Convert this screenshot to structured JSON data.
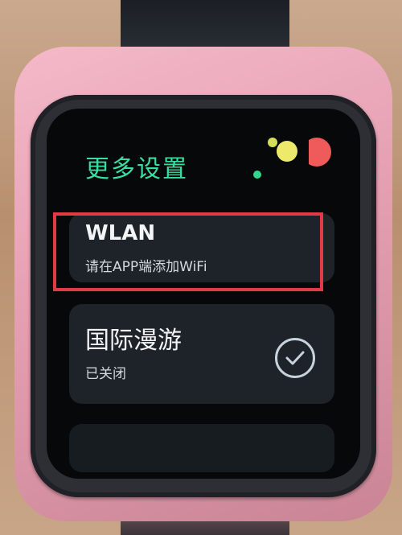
{
  "screen": {
    "title": "更多设置",
    "items": [
      {
        "label": "WLAN",
        "subtitle": "请在APP端添加WiFi"
      },
      {
        "label": "国际漫游",
        "subtitle": "已关闭",
        "toggle_icon": "check-circle-icon"
      }
    ]
  },
  "colors": {
    "title": "#37e0a2",
    "highlight": "#e43a45",
    "case": "#f4b9c9"
  }
}
